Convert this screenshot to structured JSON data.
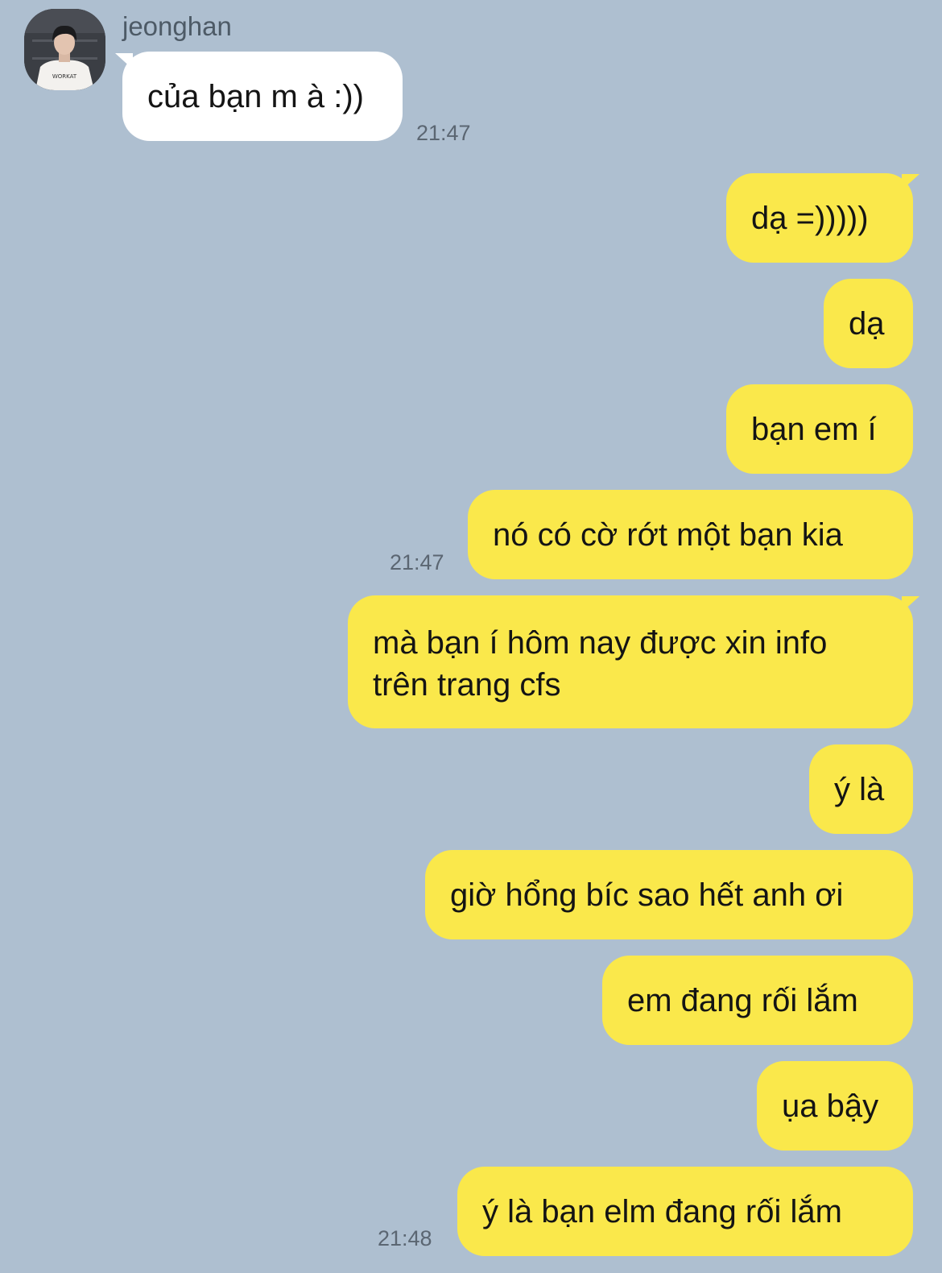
{
  "contact": {
    "name": "jeonghan",
    "avatar_icon": "profile-photo"
  },
  "messages": [
    {
      "side": "in",
      "text": "của bạn m à :))",
      "time": "21:47"
    },
    {
      "side": "out",
      "text": "dạ =)))))"
    },
    {
      "side": "out",
      "text": "dạ"
    },
    {
      "side": "out",
      "text": "bạn em í"
    },
    {
      "side": "out",
      "text": "nó có cờ rớt một bạn kia",
      "time": "21:47"
    },
    {
      "side": "out",
      "text": "mà bạn í hôm nay được xin info trên trang cfs"
    },
    {
      "side": "out",
      "text": "ý là"
    },
    {
      "side": "out",
      "text": "giờ hổng bíc sao hết anh ơi"
    },
    {
      "side": "out",
      "text": "em đang rối lắm"
    },
    {
      "side": "out",
      "text": "ụa bậy"
    },
    {
      "side": "out",
      "text": "ý là bạn elm đang rối lắm",
      "time": "21:48"
    }
  ],
  "colors": {
    "background": "#aebfd0",
    "incoming_bubble": "#ffffff",
    "outgoing_bubble": "#fae84b",
    "timestamp": "#5b6672"
  }
}
